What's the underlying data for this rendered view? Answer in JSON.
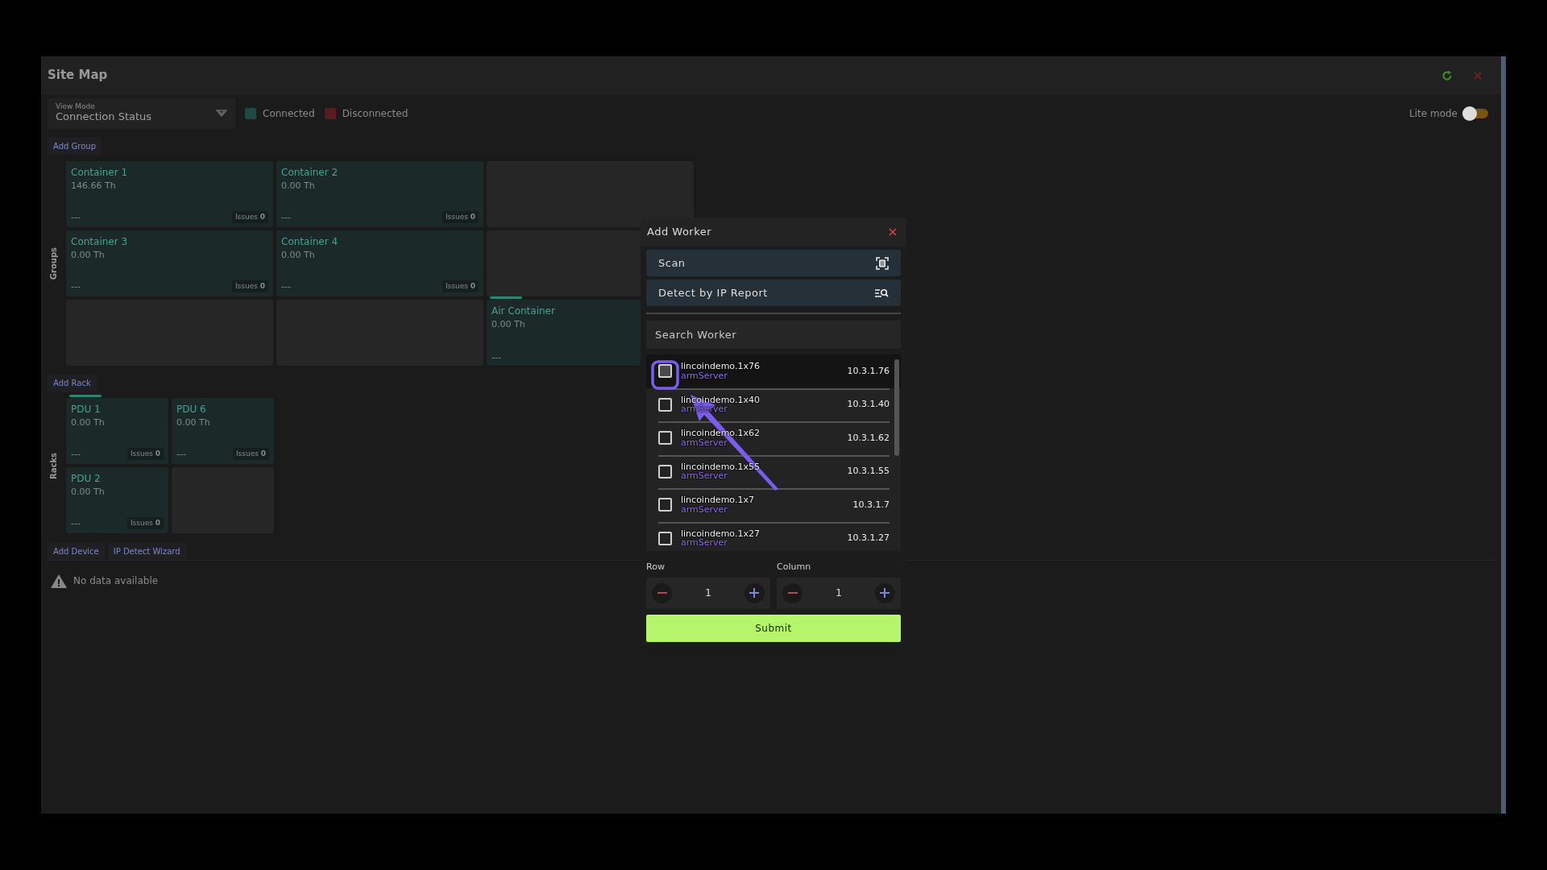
{
  "window": {
    "title": "Site Map"
  },
  "toolbar": {
    "view_mode": {
      "label": "View Mode",
      "value": "Connection Status"
    },
    "legend": [
      {
        "label": "Connected",
        "color": "#1d4a44"
      },
      {
        "label": "Disconnected",
        "color": "#5a1c1c"
      }
    ],
    "lite_mode": {
      "label": "Lite mode",
      "on": false
    }
  },
  "groups": {
    "add_button": "Add Group",
    "label": "Groups",
    "cells": [
      {
        "kind": "container",
        "name": "Container 1",
        "hashrate": "146.66 Th",
        "status": "---",
        "issues_label": "Issues",
        "issues": "0",
        "marked": false
      },
      {
        "kind": "container",
        "name": "Container 2",
        "hashrate": "0.00 Th",
        "status": "---",
        "issues_label": "Issues",
        "issues": "0",
        "marked": false
      },
      {
        "kind": "empty"
      },
      {
        "kind": "container",
        "name": "Container 3",
        "hashrate": "0.00 Th",
        "status": "---",
        "issues_label": "Issues",
        "issues": "0",
        "marked": false
      },
      {
        "kind": "container",
        "name": "Container 4",
        "hashrate": "0.00 Th",
        "status": "---",
        "issues_label": "Issues",
        "issues": "0",
        "marked": false
      },
      {
        "kind": "empty"
      },
      {
        "kind": "empty"
      },
      {
        "kind": "empty"
      },
      {
        "kind": "container",
        "name": "Air Container",
        "hashrate": "0.00 Th",
        "status": "---",
        "marked": true
      }
    ]
  },
  "racks": {
    "add_button": "Add Rack",
    "label": "Racks",
    "cells": [
      {
        "kind": "container",
        "name": "PDU 1",
        "hashrate": "0.00 Th",
        "status": "---",
        "issues_label": "Issues",
        "issues": "0",
        "marked": true
      },
      {
        "kind": "container",
        "name": "PDU 6",
        "hashrate": "0.00 Th",
        "status": "---",
        "issues_label": "Issues",
        "issues": "0",
        "marked": false
      },
      {
        "kind": "container",
        "name": "PDU 2",
        "hashrate": "0.00 Th",
        "status": "---",
        "issues_label": "Issues",
        "issues": "0",
        "marked": false
      },
      {
        "kind": "empty"
      }
    ]
  },
  "devices": {
    "buttons": [
      "Add Device",
      "IP Detect Wizard"
    ],
    "empty_message": "No data available"
  },
  "dialog": {
    "title": "Add Worker",
    "actions": [
      {
        "label": "Scan",
        "kind": "scan"
      },
      {
        "label": "Detect by IP Report",
        "kind": "detect"
      }
    ],
    "search": {
      "placeholder": "Search Worker"
    },
    "workers": [
      {
        "name": "lincoindemo.1x76",
        "type": "armServer",
        "ip": "10.3.1.76",
        "checked": false,
        "hovered": true
      },
      {
        "name": "lincoindemo.1x40",
        "type": "armServer",
        "ip": "10.3.1.40",
        "checked": false,
        "hovered": false
      },
      {
        "name": "lincoindemo.1x62",
        "type": "armServer",
        "ip": "10.3.1.62",
        "checked": false,
        "hovered": false
      },
      {
        "name": "lincoindemo.1x55",
        "type": "armServer",
        "ip": "10.3.1.55",
        "checked": false,
        "hovered": false
      },
      {
        "name": "lincoindemo.1x7",
        "type": "armServer",
        "ip": "10.3.1.7",
        "checked": false,
        "hovered": false
      },
      {
        "name": "lincoindemo.1x27",
        "type": "armServer",
        "ip": "10.3.1.27",
        "checked": false,
        "hovered": false
      }
    ],
    "steppers": [
      {
        "label": "Row",
        "value": "1"
      },
      {
        "label": "Column",
        "value": "1"
      }
    ],
    "submit": "Submit"
  }
}
